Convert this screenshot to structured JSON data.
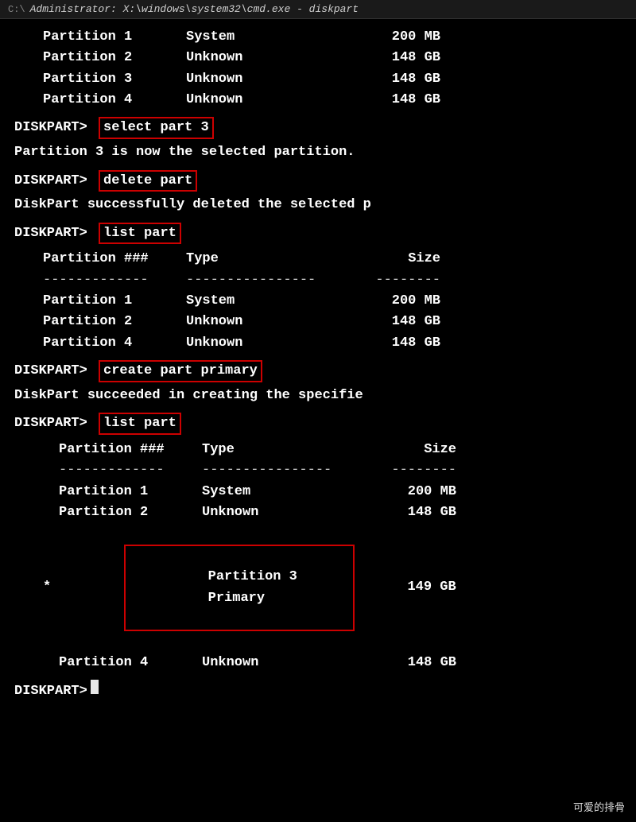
{
  "titleBar": {
    "icon": "C:\\",
    "title": "Administrator: X:\\windows\\system32\\cmd.exe - diskpart"
  },
  "terminal": {
    "watermark": "可爱的排骨",
    "sections": [
      {
        "type": "partition-list-initial",
        "rows": [
          {
            "name": "Partition 1",
            "type": "System",
            "size": "200 MB"
          },
          {
            "name": "Partition 2",
            "type": "Unknown",
            "size": "148 GB"
          },
          {
            "name": "Partition 3",
            "type": "Unknown",
            "size": "148 GB"
          },
          {
            "name": "Partition 4",
            "type": "Unknown",
            "size": "148 GB"
          }
        ]
      },
      {
        "type": "command",
        "prompt": "DISKPART>",
        "command": "select part 3"
      },
      {
        "type": "output",
        "text": "Partition 3 is now the selected partition."
      },
      {
        "type": "command",
        "prompt": "DISKPART>",
        "command": "delete part"
      },
      {
        "type": "output",
        "text": "DiskPart successfully deleted the selected p"
      },
      {
        "type": "command",
        "prompt": "DISKPART>",
        "command": "list part"
      },
      {
        "type": "partition-list",
        "headers": {
          "partition": "Partition ###",
          "type": "Type",
          "size": "Size"
        },
        "rows": [
          {
            "name": "Partition 1",
            "type": "System",
            "size": "200 MB",
            "star": false
          },
          {
            "name": "Partition 2",
            "type": "Unknown",
            "size": "148 GB",
            "star": false
          },
          {
            "name": "Partition 4",
            "type": "Unknown",
            "size": "148 GB",
            "star": false
          }
        ]
      },
      {
        "type": "command",
        "prompt": "DISKPART>",
        "command": "create part primary"
      },
      {
        "type": "output",
        "text": "DiskPart succeeded in creating the specifie"
      },
      {
        "type": "command",
        "prompt": "DISKPART>",
        "command": "list part"
      },
      {
        "type": "partition-list-final",
        "headers": {
          "partition": "Partition ###",
          "type": "Type",
          "size": "Size"
        },
        "rows": [
          {
            "name": "Partition 1",
            "type": "System",
            "size": "200 MB",
            "star": false,
            "highlight": false
          },
          {
            "name": "Partition 2",
            "type": "Unknown",
            "size": "148 GB",
            "star": false,
            "highlight": false
          },
          {
            "name": "Partition 3",
            "type": "Primary",
            "size": "149 GB",
            "star": true,
            "highlight": true
          },
          {
            "name": "Partition 4",
            "type": "Unknown",
            "size": "148 GB",
            "star": false,
            "highlight": false
          }
        ]
      },
      {
        "type": "prompt-only",
        "prompt": "DISKPART>"
      }
    ]
  }
}
